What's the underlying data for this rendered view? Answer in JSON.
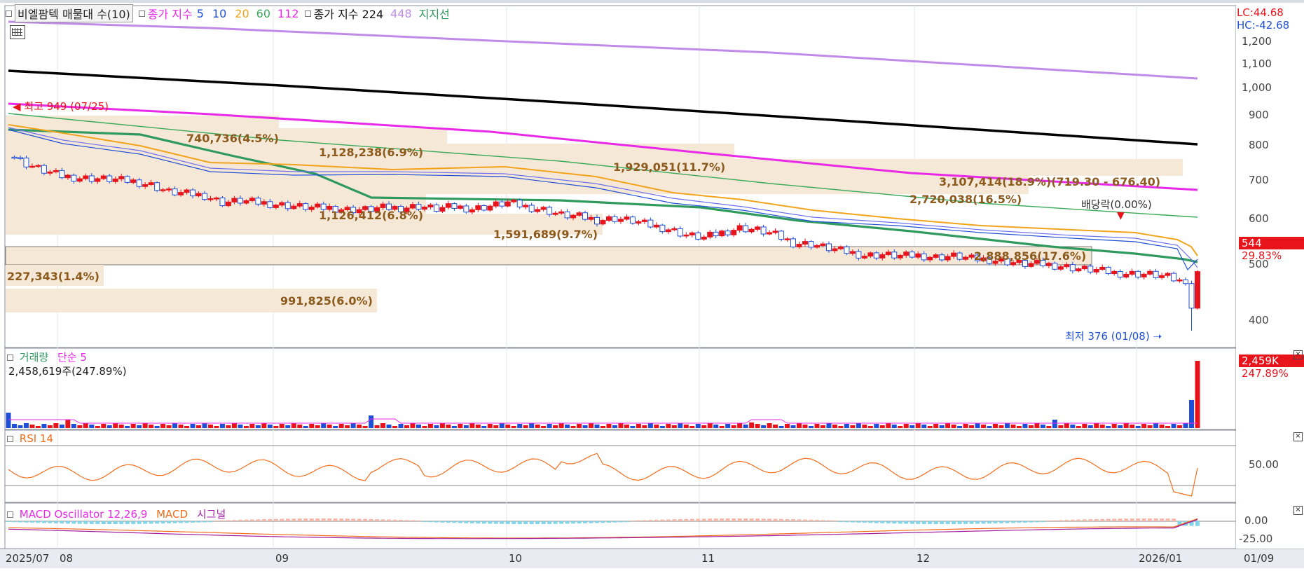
{
  "header": {
    "title": "비엘팜텍 매물대 수(10)",
    "ma_label": "종가 지수",
    "ma_periods": [
      "5",
      "10",
      "20",
      "60",
      "112"
    ],
    "ma_long_label": "종가 지수 224",
    "ma_long2": "448",
    "support_label": "지지선"
  },
  "right_axis": {
    "lc": "LC:44.68",
    "hc": "HC:-42.68",
    "ticks": [
      "1,200",
      "1,100",
      "1,000",
      "900",
      "800",
      "700",
      "600",
      "500",
      "400"
    ],
    "price_tag": "544",
    "change_tag": "29.83%"
  },
  "annotations": {
    "high": "최고 949 (07/25)",
    "low": "최저 376 (01/08)",
    "dividend": "배당락(0.00%)"
  },
  "volume_profile": [
    {
      "label": "740,736(4.5%)"
    },
    {
      "label": "1,128,238(6.9%)"
    },
    {
      "label": "1,929,051(11.7%)"
    },
    {
      "label": "3,107,414(18.9%)(719.30 - 676.40)"
    },
    {
      "label": "2,720,038(16.5%)"
    },
    {
      "label": "1,126,412(6.8%)"
    },
    {
      "label": "1,591,689(9.7%)"
    },
    {
      "label": "2,888,856(17.6%)"
    },
    {
      "label": "227,343(1.4%)"
    },
    {
      "label": "991,825(6.0%)"
    }
  ],
  "volume_panel": {
    "title": "거래량",
    "ma_label": "단순 5",
    "value_text": "2,458,619주(247.89%)",
    "tag": "2,459K",
    "tag_pct": "247.89%"
  },
  "rsi_panel": {
    "title": "RSI 14",
    "tick": "50.00"
  },
  "macd_panel": {
    "title": "MACD Oscillator 12,26,9",
    "macd_label": "MACD",
    "signal_label": "시그널",
    "ticks": [
      "0.00",
      "-25.00"
    ]
  },
  "x_axis": {
    "labels": [
      "2025/07",
      "08",
      "09",
      "10",
      "11",
      "12",
      "2026/01"
    ],
    "cursor_label": "01/09"
  },
  "colors": {
    "up": "#e8141c",
    "down": "#1f4fd6",
    "ma5": "#1f4fd6",
    "ma20": "#f2a31c",
    "ma60": "#3aaa5a",
    "ma112": "#e82ae8",
    "ma224": "#000000",
    "ma448": "#c08be8",
    "support": "#2f9a5e",
    "profile": "#f6e8d6"
  },
  "chart_data": {
    "type": "candlestick",
    "title": "비엘팜텍 매물대 수(10)",
    "x_axis_months": [
      "2025/07",
      "08",
      "09",
      "10",
      "11",
      "12",
      "2026/01"
    ],
    "price_axis_ticks": [
      1200,
      1100,
      1000,
      900,
      800,
      700,
      600,
      500,
      400
    ],
    "ylim": [
      360,
      1280
    ],
    "period_high": {
      "value": 949,
      "date": "07/25"
    },
    "period_low": {
      "value": 376,
      "date": "01/08"
    },
    "last_close": 544,
    "last_change_pct": 29.83,
    "closing_series": [
      [
        0,
        880
      ],
      [
        3,
        850
      ],
      [
        6,
        830
      ],
      [
        9,
        815
      ],
      [
        12,
        810
      ],
      [
        15,
        808
      ],
      [
        18,
        805
      ],
      [
        21,
        800
      ],
      [
        24,
        790
      ],
      [
        27,
        770
      ],
      [
        30,
        765
      ],
      [
        33,
        760
      ],
      [
        36,
        740
      ],
      [
        39,
        745
      ],
      [
        42,
        740
      ],
      [
        45,
        735
      ],
      [
        48,
        730
      ],
      [
        51,
        725
      ],
      [
        54,
        725
      ],
      [
        57,
        720
      ],
      [
        60,
        720
      ],
      [
        63,
        725
      ],
      [
        66,
        725
      ],
      [
        69,
        730
      ],
      [
        72,
        722
      ],
      [
        75,
        728
      ],
      [
        78,
        722
      ],
      [
        81,
        730
      ],
      [
        84,
        740
      ],
      [
        87,
        728
      ],
      [
        90,
        720
      ],
      [
        93,
        705
      ],
      [
        96,
        700
      ],
      [
        99,
        690
      ],
      [
        102,
        695
      ],
      [
        105,
        688
      ],
      [
        108,
        675
      ],
      [
        111,
        665
      ],
      [
        114,
        648
      ],
      [
        117,
        640
      ],
      [
        120,
        655
      ],
      [
        123,
        668
      ],
      [
        126,
        662
      ],
      [
        129,
        648
      ],
      [
        132,
        625
      ],
      [
        135,
        622
      ],
      [
        138,
        610
      ],
      [
        141,
        600
      ],
      [
        144,
        590
      ],
      [
        147,
        592
      ],
      [
        150,
        588
      ],
      [
        153,
        590
      ],
      [
        156,
        585
      ],
      [
        159,
        588
      ],
      [
        162,
        580
      ],
      [
        165,
        578
      ],
      [
        168,
        572
      ],
      [
        171,
        565
      ],
      [
        174,
        565
      ],
      [
        177,
        560
      ],
      [
        180,
        552
      ],
      [
        183,
        548
      ],
      [
        186,
        540
      ],
      [
        189,
        538
      ],
      [
        192,
        536
      ],
      [
        195,
        528
      ],
      [
        198,
        510
      ],
      [
        199,
        440
      ],
      [
        200,
        544
      ]
    ],
    "moving_averages": [
      {
        "name": "224",
        "points": [
          [
            0,
            1072
          ],
          [
            200,
            810
          ]
        ]
      },
      {
        "name": "448",
        "points": [
          [
            0,
            1245
          ],
          [
            200,
            1040
          ]
        ]
      },
      {
        "name": "112",
        "points": [
          [
            0,
            960
          ],
          [
            60,
            900
          ],
          [
            120,
            820
          ],
          [
            160,
            760
          ],
          [
            200,
            678
          ]
        ]
      },
      {
        "name": "60",
        "points": [
          [
            0,
            900
          ],
          [
            50,
            840
          ],
          [
            100,
            760
          ],
          [
            150,
            690
          ],
          [
            200,
            600
          ]
        ]
      }
    ],
    "support_line": [
      [
        0,
        770
      ],
      [
        35,
        740
      ],
      [
        60,
        690
      ],
      [
        85,
        655
      ],
      [
        110,
        650
      ],
      [
        135,
        620
      ],
      [
        160,
        580
      ],
      [
        180,
        540
      ],
      [
        200,
        505
      ]
    ],
    "volume_profile": [
      {
        "shares": 740736,
        "pct": 4.5
      },
      {
        "shares": 1128238,
        "pct": 6.9
      },
      {
        "shares": 1929051,
        "pct": 11.7
      },
      {
        "shares": 3107414,
        "pct": 18.9,
        "range": [
          676.4,
          719.3
        ]
      },
      {
        "shares": 2720038,
        "pct": 16.5
      },
      {
        "shares": 1126412,
        "pct": 6.8
      },
      {
        "shares": 1591689,
        "pct": 9.7
      },
      {
        "shares": 2888856,
        "pct": 17.6
      },
      {
        "shares": 227343,
        "pct": 1.4
      },
      {
        "shares": 991825,
        "pct": 6.0
      }
    ],
    "volume": {
      "last_shares": 2458619,
      "last_pct": 247.89
    },
    "rsi": {
      "period": 14,
      "reference": 50
    },
    "macd": {
      "params": [
        12,
        26,
        9
      ],
      "ticks": [
        0,
        -25
      ]
    }
  }
}
